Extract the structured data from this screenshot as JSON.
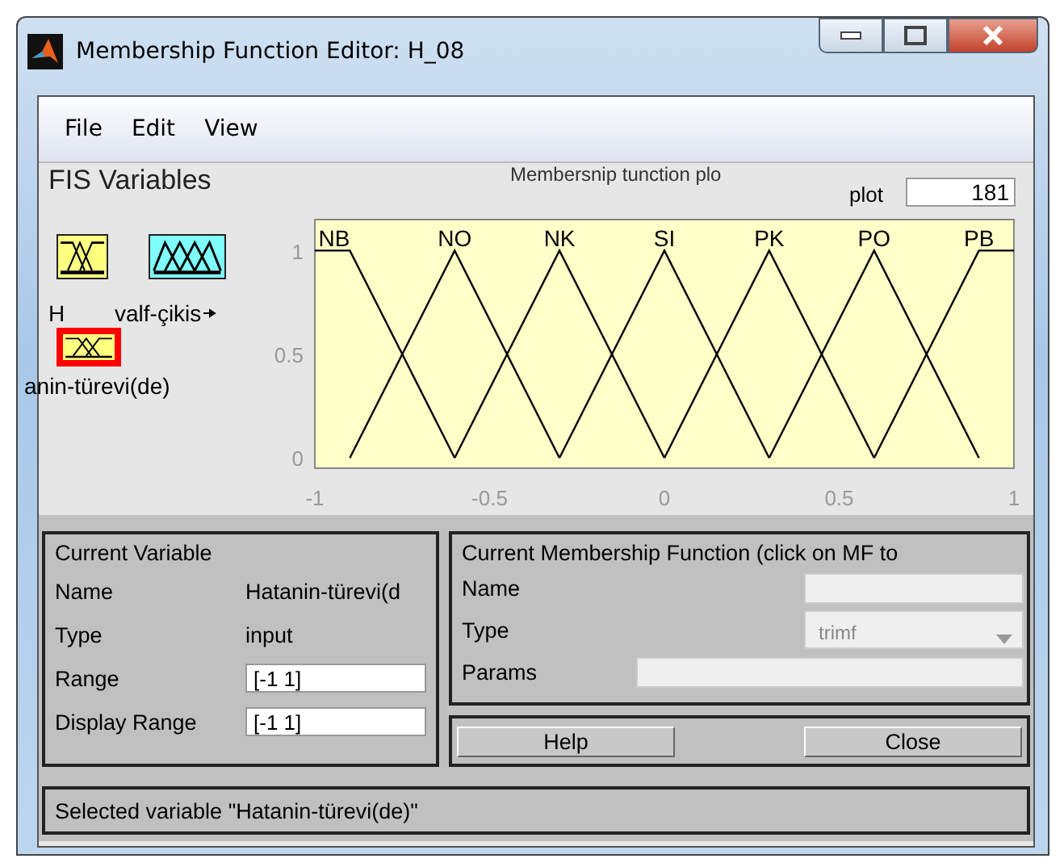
{
  "window": {
    "title": "Membership Function Editor: H_08"
  },
  "menu": [
    "File",
    "Edit",
    "View"
  ],
  "fis_variables": {
    "title": "FIS Variables",
    "items": [
      {
        "kind": "input",
        "label": "H",
        "selected": false
      },
      {
        "kind": "output",
        "label": "valf-çikis",
        "selected": false
      },
      {
        "kind": "input",
        "label": "anin-türevi(de)",
        "selected": true
      }
    ]
  },
  "plot": {
    "title": "Membersnip tunction plo",
    "points_label": "plot",
    "points": "181",
    "chart_data": {
      "type": "line",
      "x": [
        -1,
        -0.9,
        -0.6,
        -0.3,
        0,
        0.3,
        0.6,
        0.9,
        1
      ],
      "xlim": [
        -1,
        1
      ],
      "ylim": [
        -0.05,
        1.15
      ],
      "xticks": [
        -1,
        -0.5,
        0,
        0.5,
        1
      ],
      "yticks": [
        0,
        0.5,
        1
      ],
      "series": [
        {
          "name": "NB",
          "color": "#000000",
          "values": [
            1,
            1,
            0,
            null,
            null,
            null,
            null,
            null,
            null
          ]
        },
        {
          "name": "NO",
          "color": "#000000",
          "values": [
            null,
            0,
            1,
            0,
            null,
            null,
            null,
            null,
            null
          ]
        },
        {
          "name": "NK",
          "color": "#000000",
          "values": [
            null,
            null,
            0,
            1,
            0,
            null,
            null,
            null,
            null
          ]
        },
        {
          "name": "SI",
          "color": "#000000",
          "values": [
            null,
            null,
            null,
            0,
            1,
            0,
            null,
            null,
            null
          ]
        },
        {
          "name": "PK",
          "color": "#000000",
          "values": [
            null,
            null,
            null,
            null,
            0,
            1,
            0,
            null,
            null
          ]
        },
        {
          "name": "PO",
          "color": "#000000",
          "values": [
            null,
            null,
            null,
            null,
            null,
            0,
            1,
            0,
            null
          ]
        },
        {
          "name": "PB",
          "color": "#000000",
          "values": [
            null,
            null,
            null,
            null,
            null,
            null,
            0,
            1,
            1
          ]
        }
      ]
    }
  },
  "current_variable": {
    "title": "Current Variable",
    "rows": [
      {
        "kind": "text",
        "label": "Name",
        "value": "Hatanin-türevi(d"
      },
      {
        "kind": "text",
        "label": "Type",
        "value": "input"
      },
      {
        "kind": "field",
        "label": "Range",
        "value": "[-1 1]"
      },
      {
        "kind": "field",
        "label": "Display Range",
        "value": "[-1 1]"
      }
    ]
  },
  "current_mf": {
    "title": "Current Membership Function (click on MF to",
    "name_label": "Name",
    "type_label": "Type",
    "type_value": "trimf",
    "params_label": "Params"
  },
  "buttons": [
    "Help",
    "Close"
  ],
  "status": "Selected variable \"Hatanin-türevi(de)\""
}
